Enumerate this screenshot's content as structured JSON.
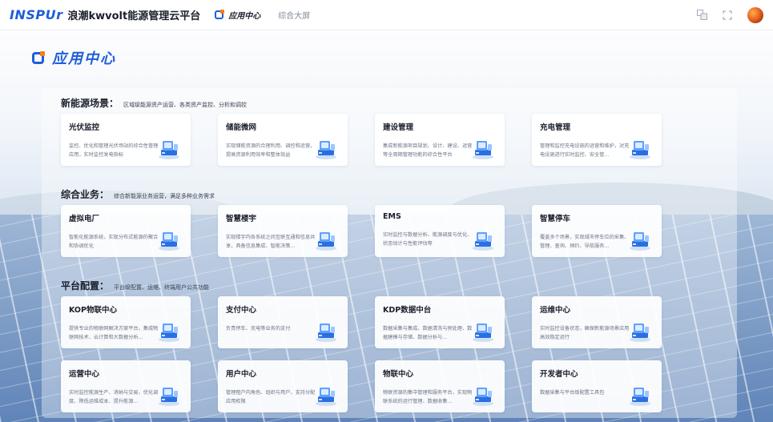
{
  "header": {
    "logo": "INSPUr",
    "title": "浪潮kwvolt能源管理云平台",
    "tabs": [
      {
        "label": "应用中心",
        "active": true
      },
      {
        "label": "综合大屏",
        "active": false
      }
    ],
    "icons": [
      "translate-icon",
      "fullscreen-icon"
    ],
    "accent_color": "#1f5fd8",
    "orange_color": "#ff7a1a"
  },
  "page": {
    "title": "应用中心"
  },
  "sections": [
    {
      "name": "新能源场景：",
      "desc": "区域级能源资产运营、各类资产监控、分析和调控",
      "cards": [
        {
          "title": "光伏监控",
          "desc": "监控、优化和管理光伏场站的综合性管理应用，实时监控发电指标",
          "icon": "solar-monitor-icon"
        },
        {
          "title": "储能微网",
          "desc": "实现储能资源的合理利用、调控和运营，提高资源利用效率和整体效益",
          "icon": "battery-grid-icon"
        },
        {
          "title": "建设管理",
          "desc": "集成新能源项目规划、设计、建设、运营等全周期管理功能的综合性平台",
          "icon": "construction-icon"
        },
        {
          "title": "充电管理",
          "desc": "管理和监控充电设施的运营和维护，对充电设施进行实时监控、安全管...",
          "icon": "charging-icon"
        }
      ]
    },
    {
      "name": "综合业务：",
      "desc": "综合新能源业务运营，满足多种业务需求",
      "cards": [
        {
          "title": "虚拟电厂",
          "desc": "智能化能源系统，实现分布式能源的聚合和协调优化",
          "icon": "virtual-plant-icon"
        },
        {
          "title": "智慧楼宇",
          "desc": "实现楼宇内各系统之间互联互通和信息共享，具备信息集成、智能决策...",
          "icon": "smart-building-icon"
        },
        {
          "title": "EMS",
          "desc": "实时监控与数据分析、能源调度与优化、状态估计与性能评估等",
          "icon": "ems-icon"
        },
        {
          "title": "智慧停车",
          "desc": "覆盖多个场景，实现城市停车位的采集、管理、查询、预约、导航服务...",
          "icon": "parking-icon"
        }
      ]
    },
    {
      "name": "平台配置：",
      "desc": "平台级配置、运维、终端用户公共功能",
      "cards": [
        {
          "title": "KOP物联中心",
          "desc": "提供专业的物联网解决方案平台，集成物联网技术、云计算和大数据分析...",
          "icon": "iot-hub-icon"
        },
        {
          "title": "支付中心",
          "desc": "负责停车、充电等业务的支付",
          "icon": "payment-icon"
        },
        {
          "title": "KDP数据中台",
          "desc": "数据采集与集成、数据清洗与预处理、数据建模与存储、数据分析与...",
          "icon": "data-platform-icon"
        },
        {
          "title": "运维中心",
          "desc": "实时监控设备状态，确保新能源场景应用高效稳定运行",
          "icon": "maintenance-icon"
        },
        {
          "title": "运营中心",
          "desc": "实时监控能源生产、消纳与交易，优化调度、降低运维成本、提升能源...",
          "icon": "operation-icon"
        },
        {
          "title": "用户中心",
          "desc": "管理租户内角色、组织与用户，支持分配应用权限",
          "icon": "user-center-icon"
        },
        {
          "title": "物联中心",
          "desc": "物联资源的集中管理和服务平台，实现物联系统的运行管理、数据收集...",
          "icon": "iot-center-icon"
        },
        {
          "title": "开发者中心",
          "desc": "数据采集与平台级配置工具包",
          "icon": "developer-icon"
        }
      ]
    }
  ]
}
